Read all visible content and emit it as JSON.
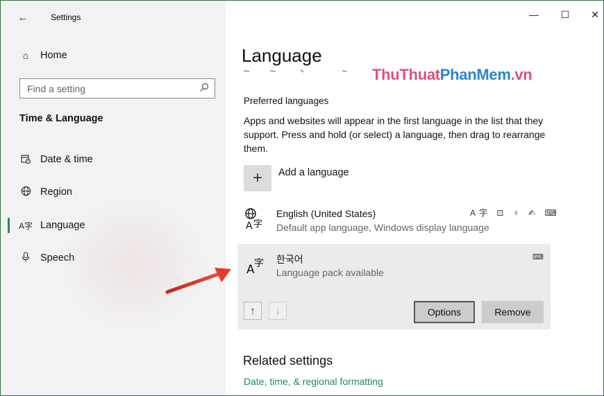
{
  "window": {
    "title": "Settings",
    "controls": {
      "minimize": "—",
      "maximize": "☐",
      "close": "✕"
    }
  },
  "sidebar": {
    "back_icon": "←",
    "home": {
      "label": "Home",
      "icon": "⌂"
    },
    "search": {
      "placeholder": "Find a setting",
      "icon": "⌕"
    },
    "section_title": "Time & Language",
    "items": [
      {
        "label": "Date & time",
        "icon": "calendar-clock-icon"
      },
      {
        "label": "Region",
        "icon": "globe-icon"
      },
      {
        "label": "Language",
        "icon": "language-icon",
        "active": true
      },
      {
        "label": "Speech",
        "icon": "microphone-icon"
      }
    ]
  },
  "main": {
    "title": "Language",
    "watermark": {
      "part1": "ThuThuat",
      "part2": "PhanMem",
      "part3": ".vn"
    },
    "preferred_heading": "Preferred languages",
    "preferred_desc": "Apps and websites will appear in the first language in the list that they support. Press and hold (or select) a language, then drag to rearrange them.",
    "add_language": {
      "icon": "+",
      "label": "Add a language"
    },
    "languages": [
      {
        "name": "English (United States)",
        "sub": "Default app language, Windows display language",
        "features": "A字 ⊡ ♀ ✍ ⌨"
      },
      {
        "name": "한국어",
        "sub": "Language pack available",
        "features": "⌨",
        "selected": true
      }
    ],
    "buttons": {
      "up": "↑",
      "down": "↓",
      "options": "Options",
      "remove": "Remove"
    },
    "related": {
      "title": "Related settings",
      "link": "Date, time, & regional formatting"
    }
  },
  "colors": {
    "accent": "#1f8a58",
    "watermark_pink": "#e0507a",
    "watermark_blue": "#2a86c8",
    "annotation_arrow": "#e03a2f"
  }
}
